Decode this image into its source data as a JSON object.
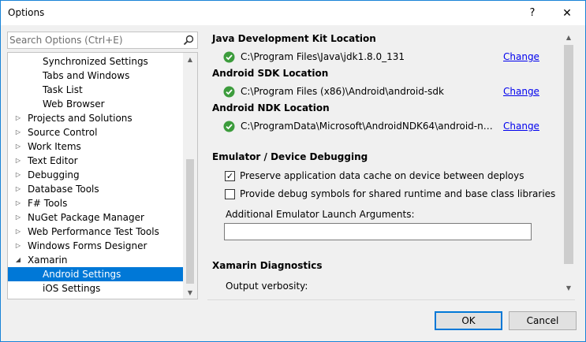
{
  "window": {
    "title": "Options",
    "help_glyph": "?",
    "close_glyph": "✕"
  },
  "search": {
    "placeholder": "Search Options (Ctrl+E)",
    "value": ""
  },
  "tree": {
    "items": [
      {
        "label": "Synchronized Settings",
        "level": 2
      },
      {
        "label": "Tabs and Windows",
        "level": 2
      },
      {
        "label": "Task List",
        "level": 2
      },
      {
        "label": "Web Browser",
        "level": 2
      },
      {
        "label": "Projects and Solutions",
        "level": 1,
        "arrow": "▷"
      },
      {
        "label": "Source Control",
        "level": 1,
        "arrow": "▷"
      },
      {
        "label": "Work Items",
        "level": 1,
        "arrow": "▷"
      },
      {
        "label": "Text Editor",
        "level": 1,
        "arrow": "▷"
      },
      {
        "label": "Debugging",
        "level": 1,
        "arrow": "▷"
      },
      {
        "label": "Database Tools",
        "level": 1,
        "arrow": "▷"
      },
      {
        "label": "F# Tools",
        "level": 1,
        "arrow": "▷"
      },
      {
        "label": "NuGet Package Manager",
        "level": 1,
        "arrow": "▷"
      },
      {
        "label": "Web Performance Test Tools",
        "level": 1,
        "arrow": "▷"
      },
      {
        "label": "Windows Forms Designer",
        "level": 1,
        "arrow": "▷"
      },
      {
        "label": "Xamarin",
        "level": 1,
        "arrow": "◢"
      },
      {
        "label": "Android Settings",
        "level": 2,
        "selected": true
      },
      {
        "label": "iOS Settings",
        "level": 2
      }
    ]
  },
  "sdk": {
    "jdk_heading": "Java Development Kit Location",
    "jdk_path": "C:\\Program Files\\Java\\jdk1.8.0_131",
    "android_sdk_heading": "Android SDK Location",
    "android_sdk_path": "C:\\Program Files (x86)\\Android\\android-sdk",
    "android_ndk_heading": "Android NDK Location",
    "android_ndk_path": "C:\\ProgramData\\Microsoft\\AndroidNDK64\\android-ndk...",
    "change_label": "Change"
  },
  "emulator": {
    "heading": "Emulator / Device Debugging",
    "preserve_cache_label": "Preserve application data cache on device between deploys",
    "preserve_cache_checked": true,
    "debug_symbols_label": "Provide debug symbols for shared runtime and base class libraries",
    "debug_symbols_checked": false,
    "launch_args_label": "Additional Emulator Launch Arguments:",
    "launch_args_value": ""
  },
  "diagnostics": {
    "heading": "Xamarin Diagnostics",
    "verbosity_label": "Output verbosity:"
  },
  "buttons": {
    "ok": "OK",
    "cancel": "Cancel"
  },
  "glyphs": {
    "scroll_up": "▲",
    "scroll_down": "▼",
    "check": "✓"
  },
  "colors": {
    "accent": "#0078d7",
    "success_green": "#3c9c3c",
    "link": "#0000ee"
  }
}
